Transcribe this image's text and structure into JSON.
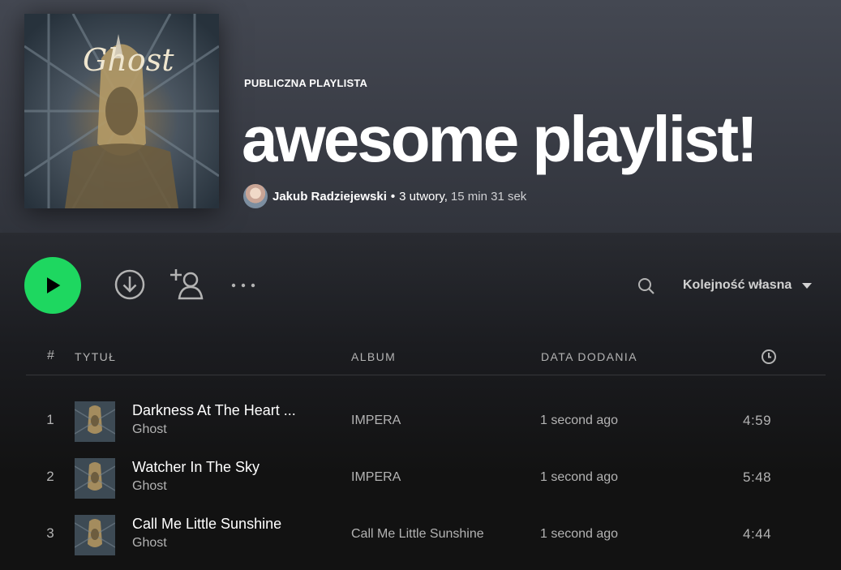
{
  "playlist": {
    "type_label": "PUBLICZNA PLAYLISTA",
    "title": "awesome playlist!",
    "owner": "Jakub Radziejewski",
    "separator": "•",
    "track_count": "3 utwory,",
    "duration": "15 min 31 sek"
  },
  "cover": {
    "band_logo": "Ghost"
  },
  "controls": {
    "play_icon": "play-icon",
    "download_icon": "download-icon",
    "add_user_icon": "add-user-icon",
    "more_icon": "more-icon",
    "search_icon": "search-icon",
    "sort_label": "Kolejność własna"
  },
  "table": {
    "headers": {
      "number": "#",
      "title": "TYTUŁ",
      "album": "ALBUM",
      "date_added": "DATA DODANIA",
      "duration_icon": "clock-icon"
    },
    "rows": [
      {
        "number": "1",
        "title": "Darkness At The Heart ...",
        "artist": "Ghost",
        "album": "IMPERA",
        "date_added": "1 second ago",
        "duration": "4:59"
      },
      {
        "number": "2",
        "title": "Watcher In The Sky",
        "artist": "Ghost",
        "album": "IMPERA",
        "date_added": "1 second ago",
        "duration": "5:48"
      },
      {
        "number": "3",
        "title": "Call Me Little Sunshine",
        "artist": "Ghost",
        "album": "Call Me Little Sunshine",
        "date_added": "1 second ago",
        "duration": "4:44"
      }
    ]
  },
  "colors": {
    "accent": "#1ed760",
    "header_bg": "#3f424b",
    "page_bg": "#121212",
    "secondary_text": "#b3b3b3"
  }
}
